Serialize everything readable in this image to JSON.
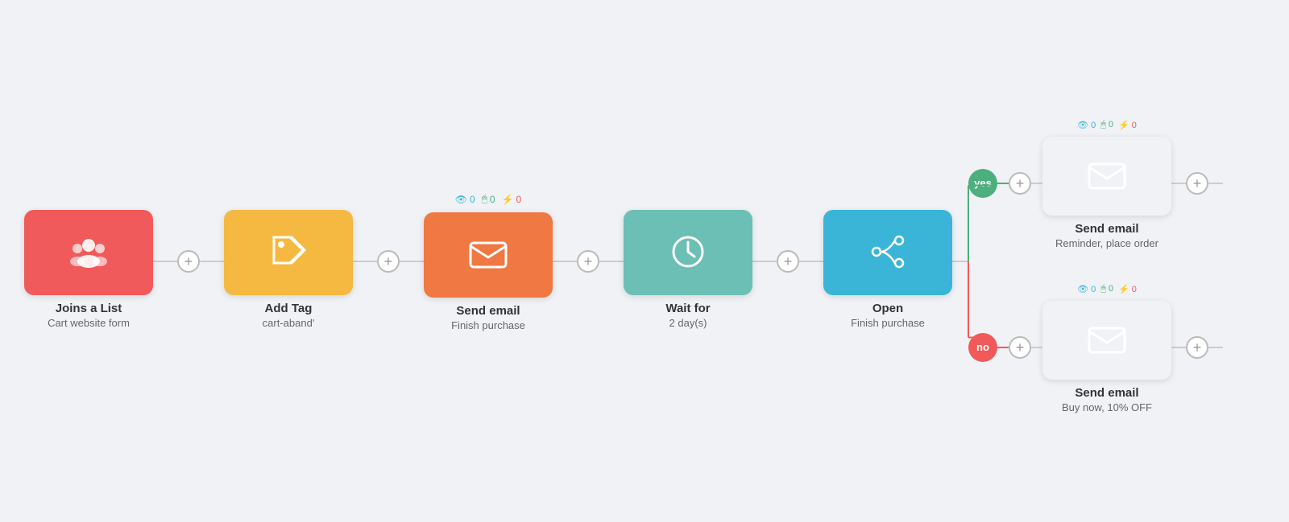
{
  "nodes": [
    {
      "id": "joins-list",
      "type": "trigger",
      "color": "red",
      "icon": "people",
      "label": "Joins a List",
      "sublabel": "Cart website form",
      "hasStats": false
    },
    {
      "id": "add-tag",
      "type": "action",
      "color": "yellow",
      "icon": "tag",
      "label": "Add Tag",
      "sublabel": "cart-aband'",
      "hasStats": false
    },
    {
      "id": "send-email-1",
      "type": "action",
      "color": "orange",
      "icon": "email",
      "label": "Send email",
      "sublabel": "Finish purchase",
      "hasStats": true,
      "stats": {
        "views": 0,
        "clicks": 0,
        "bounces": 0
      }
    },
    {
      "id": "wait-for",
      "type": "action",
      "color": "teal",
      "icon": "clock",
      "label": "Wait for",
      "sublabel": "2 day(s)",
      "hasStats": false
    },
    {
      "id": "open",
      "type": "condition",
      "color": "blue",
      "icon": "branch",
      "label": "Open",
      "sublabel": "Finish purchase",
      "hasStats": false
    }
  ],
  "branches": {
    "yes": {
      "label": "yes",
      "node": {
        "id": "send-email-yes",
        "color": "orange",
        "icon": "email",
        "label": "Send email",
        "sublabel": "Reminder, place order",
        "stats": {
          "views": 0,
          "clicks": 0,
          "bounces": 0
        }
      }
    },
    "no": {
      "label": "no",
      "node": {
        "id": "send-email-no",
        "color": "orange",
        "icon": "email",
        "label": "Send email",
        "sublabel": "Buy now, 10% OFF",
        "stats": {
          "views": 0,
          "clicks": 0,
          "bounces": 0
        }
      }
    }
  },
  "connectors": {
    "plus_label": "+"
  },
  "stats_labels": {
    "views": "0",
    "clicks": "0",
    "bounces": "0"
  }
}
